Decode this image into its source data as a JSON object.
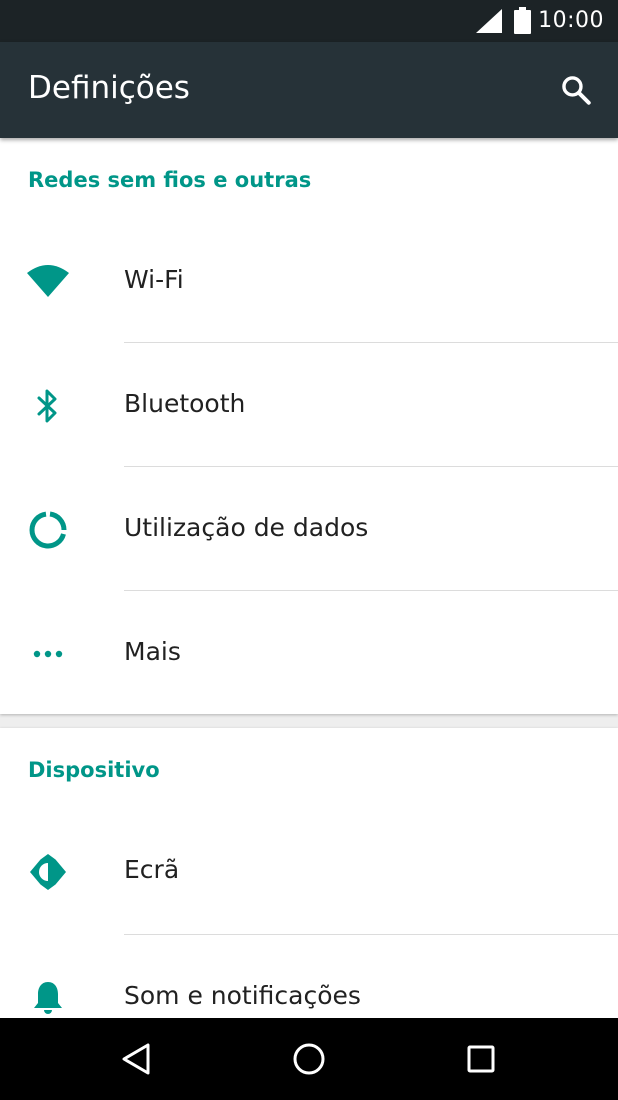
{
  "status_bar": {
    "time": "10:00",
    "signal_icon": "cell-signal-icon",
    "battery_icon": "battery-full-icon"
  },
  "app_bar": {
    "title": "Definições",
    "search_icon": "search-icon"
  },
  "sections": [
    {
      "header": "Redes sem fios e outras",
      "items": [
        {
          "label": "Wi-Fi",
          "icon": "wifi-icon"
        },
        {
          "label": "Bluetooth",
          "icon": "bluetooth-icon"
        },
        {
          "label": "Utilização de dados",
          "icon": "data-usage-icon"
        },
        {
          "label": "Mais",
          "icon": "more-dots-icon"
        }
      ]
    },
    {
      "header": "Dispositivo",
      "items": [
        {
          "label": "Ecrã",
          "icon": "brightness-icon"
        },
        {
          "label": "Som e notificações",
          "icon": "bell-icon"
        }
      ]
    }
  ],
  "nav_bar": {
    "back_icon": "back-triangle-icon",
    "home_icon": "home-circle-icon",
    "recents_icon": "recents-square-icon"
  },
  "colors": {
    "accent": "#009688",
    "app_bar": "#263238",
    "status_bar": "#1c2326",
    "background": "#eeeeee"
  }
}
